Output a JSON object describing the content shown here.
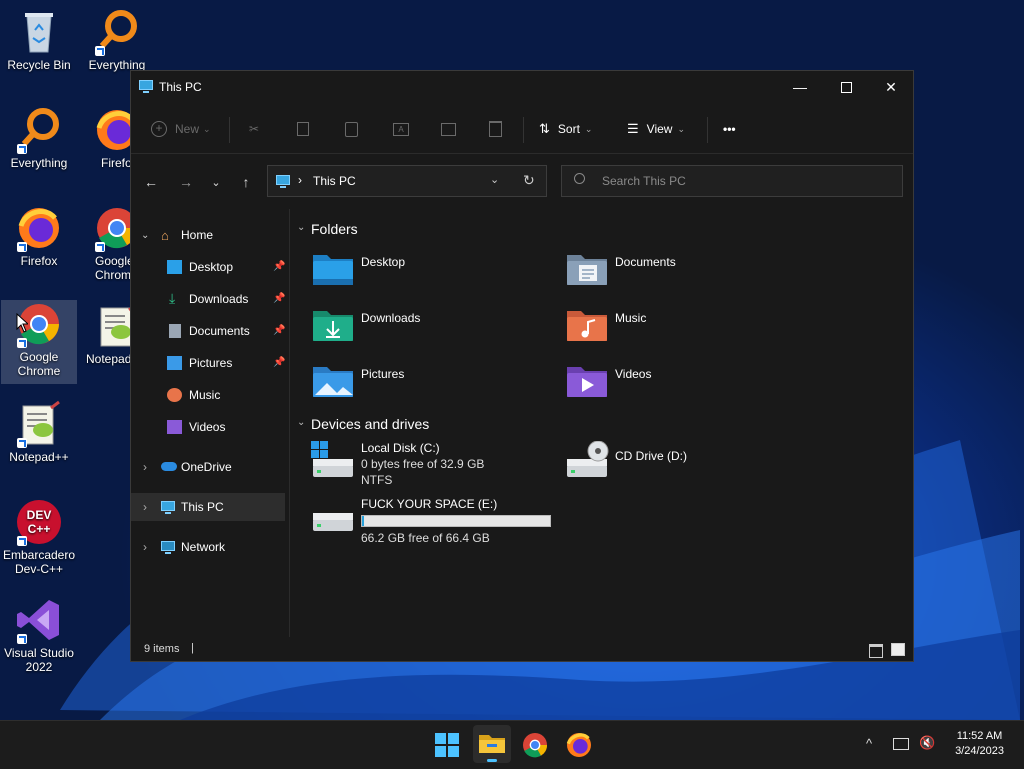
{
  "desktop": {
    "icons": [
      {
        "label": "Recycle Bin",
        "icon": "recycle-bin-icon"
      },
      {
        "label": "Everything",
        "icon": "everything-icon"
      },
      {
        "label": "Everything",
        "icon": "everything-icon"
      },
      {
        "label": "Firefox",
        "icon": "firefox-icon"
      },
      {
        "label": "Firefox",
        "icon": "firefox-icon"
      },
      {
        "label": "Google Chrome",
        "icon": "chrome-icon"
      },
      {
        "label": "Google Chrome",
        "icon": "chrome-icon"
      },
      {
        "label": "Notepad++",
        "icon": "notepadpp-icon"
      },
      {
        "label": "Notepad++",
        "icon": "notepadpp-icon"
      },
      {
        "label": "Embarcadero Dev-C++",
        "icon": "devcpp-icon"
      },
      {
        "label": "Visual Studio 2022",
        "icon": "visual-studio-icon"
      }
    ]
  },
  "window": {
    "title": "This PC",
    "controls": {
      "minimize": "—",
      "maximize": "☐",
      "close": "✕"
    },
    "toolbar": {
      "new_label": "New",
      "sort_label": "Sort",
      "view_label": "View",
      "more_label": "•••"
    },
    "address": {
      "path": "This PC"
    },
    "search": {
      "placeholder": "Search This PC"
    },
    "sidebar": {
      "home": "Home",
      "quick": [
        {
          "label": "Desktop",
          "icon": "desktop-icon",
          "pinned": true
        },
        {
          "label": "Downloads",
          "icon": "downloads-icon",
          "pinned": true
        },
        {
          "label": "Documents",
          "icon": "documents-icon",
          "pinned": true
        },
        {
          "label": "Pictures",
          "icon": "pictures-icon",
          "pinned": true
        },
        {
          "label": "Music",
          "icon": "music-icon",
          "pinned": false
        },
        {
          "label": "Videos",
          "icon": "videos-icon",
          "pinned": false
        }
      ],
      "onedrive": "OneDrive",
      "thispc": "This PC",
      "network": "Network"
    },
    "content": {
      "folders_heading": "Folders",
      "folders": [
        {
          "name": "Desktop",
          "color": "#2aa0e8"
        },
        {
          "name": "Documents",
          "color": "#8aa0b8"
        },
        {
          "name": "Downloads",
          "color": "#1fae8a"
        },
        {
          "name": "Music",
          "color": "#e8744a"
        },
        {
          "name": "Pictures",
          "color": "#3a9ae8"
        },
        {
          "name": "Videos",
          "color": "#8a5ad8"
        }
      ],
      "drives_heading": "Devices and drives",
      "drives": [
        {
          "name": "Local Disk (C:)",
          "free": "0 bytes free of 32.9 GB",
          "fs": "NTFS"
        },
        {
          "name": "CD Drive (D:)"
        },
        {
          "name": "FUCK YOUR SPACE (E:)",
          "free": "66.2 GB free of 66.4 GB",
          "used_fraction": 0.003
        }
      ]
    },
    "status": {
      "items": "9 items",
      "separator": "|"
    }
  },
  "taskbar": {
    "time": "11:52 AM",
    "date": "3/24/2023",
    "tray_chevron": "^"
  }
}
